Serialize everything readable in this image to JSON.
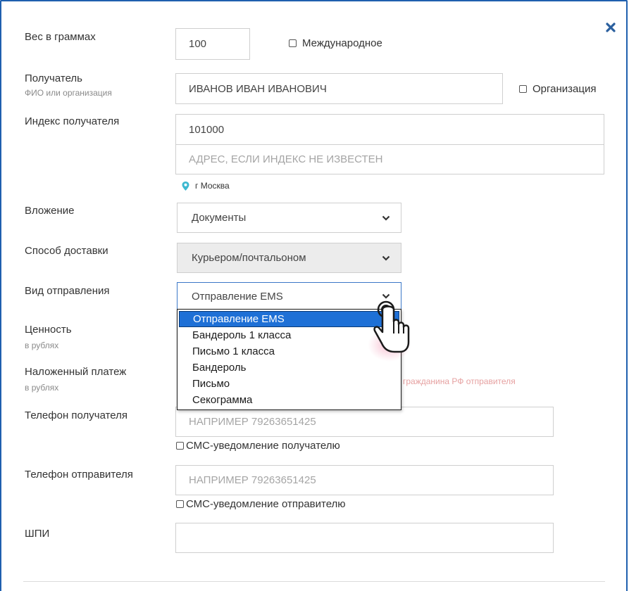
{
  "weight": {
    "label": "Вес в граммах",
    "value": "100"
  },
  "international": {
    "label": "Международное"
  },
  "recipient": {
    "label": "Получатель",
    "sublabel": "ФИО или организация",
    "value": "ИВАНОВ ИВАН ИВАНОВИЧ"
  },
  "organization": {
    "label": "Организация"
  },
  "index": {
    "label": "Индекс получателя",
    "value": "101000",
    "address_placeholder": "АДРЕС, ЕСЛИ ИНДЕКС НЕ ИЗВЕСТЕН",
    "location": "г Москва"
  },
  "attachment": {
    "label": "Вложение",
    "value": "Документы"
  },
  "delivery": {
    "label": "Способ доставки",
    "value": "Курьером/почтальоном"
  },
  "shipment": {
    "label": "Вид отправления",
    "value": "Отправление EMS",
    "options": [
      "Отправление EMS",
      "Бандероль 1 класса",
      "Письмо 1 класса",
      "Бандероль",
      "Письмо",
      "Секограмма"
    ]
  },
  "value_field": {
    "label": "Ценность",
    "sublabel": "в рублях"
  },
  "cod": {
    "label": "Наложенный платеж",
    "sublabel": "в рублях",
    "hint_visible": "гражданина РФ отправителя"
  },
  "recipient_phone": {
    "label": "Телефон получателя",
    "placeholder": "НАПРИМЕР 79263651425",
    "sms_label": "СМС-уведомление получателю"
  },
  "sender_phone": {
    "label": "Телефон отправителя",
    "placeholder": "НАПРИМЕР 79263651425",
    "sms_label": "СМС-уведомление отправителю"
  },
  "tracking": {
    "label": "ШПИ",
    "value": ""
  },
  "colors": {
    "accent": "#1e70d6",
    "frame": "#1f5fae",
    "location_icon": "#3db8d0"
  }
}
